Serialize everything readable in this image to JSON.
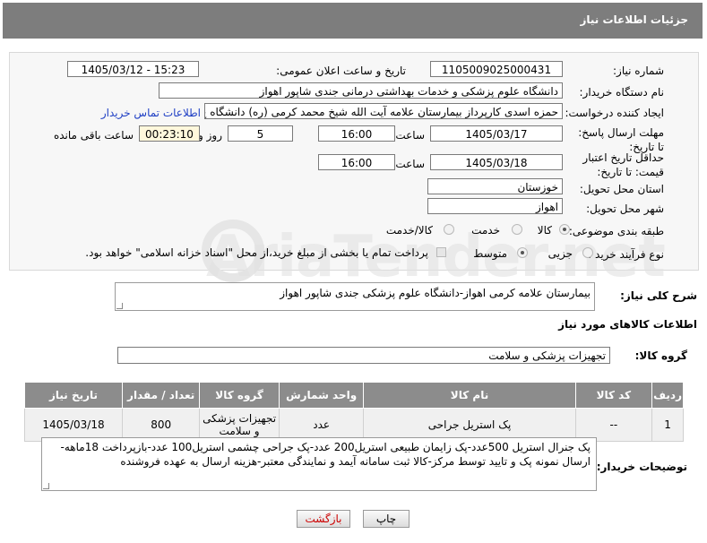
{
  "header": {
    "title": "جزئیات اطلاعات نیاز"
  },
  "form": {
    "need_number_label": "شماره نیاز:",
    "need_number": "1105009025000431",
    "announce_label": "تاریخ و ساعت اعلان عمومی:",
    "announce_value": "1405/03/12 - 15:23",
    "buyer_org_label": "نام دستگاه خریدار:",
    "buyer_org": "دانشگاه علوم پزشکی و خدمات بهداشتی درمانی جندی شاپور اهواز",
    "requester_label": "ایجاد کننده درخواست:",
    "requester": "حمزه اسدی کارپرداز بیمارستان علامه آیت الله شیخ محمد کرمی (ره) دانشگاه ع",
    "contact_link": "اطلاعات تماس خریدار",
    "deadline_label": "مهلت ارسال پاسخ: تا تاریخ:",
    "deadline_date": "1405/03/17",
    "time_label": "ساعت",
    "deadline_time": "16:00",
    "days_value": "5",
    "days_label": "روز و",
    "remaining_value": "00:23:10",
    "remaining_label": "ساعت باقی مانده",
    "validity_label": "حداقل تاریخ اعتبار قیمت: تا تاریخ:",
    "validity_date": "1405/03/18",
    "validity_time_label": "ساعت",
    "validity_time": "16:00",
    "province_label": "استان محل تحویل:",
    "province": "خوزستان",
    "city_label": "شهر محل تحویل:",
    "city": "اهواز",
    "category_label": "طبقه بندی موضوعی:",
    "category_options": [
      "کالا",
      "خدمت",
      "کالا/خدمت"
    ],
    "process_label": "نوع فرآیند خرید :",
    "process_options": [
      "جزیی",
      "متوسط"
    ],
    "payment_note": "پرداخت تمام یا بخشی از مبلغ خرید،از محل \"اسناد خزانه اسلامی\" خواهد بود."
  },
  "summary": {
    "label": "شرح کلی نیاز:",
    "value": "بیمارستان علامه کرمی اهواز-دانشگاه علوم پزشکی جندی شاپور اهواز"
  },
  "goods_info_title": "اطلاعات کالاهای مورد نیاز",
  "goods_group": {
    "label": "گروه کالا:",
    "value": "تجهیزات پزشکی و سلامت"
  },
  "table": {
    "headers": [
      "ردیف",
      "کد کالا",
      "نام کالا",
      "واحد شمارش",
      "گروه کالا",
      "تعداد / مقدار",
      "تاریخ نیاز"
    ],
    "rows": [
      [
        "1",
        "--",
        "پک استریل جراحی",
        "عدد",
        "تجهیزات پزشکی و سلامت",
        "800",
        "1405/03/18"
      ]
    ]
  },
  "buyer_notes": {
    "label": "توضیحات خریدار:",
    "value": "پک جنرال استریل 500عدد-پک زایمان طبیعی استریل200 عدد-پک  جراحی چشمی  استریل100 عدد-بازپرداخت 18ماهه-ارسال نمونه پک و تایید توسط مرکز-کالا ثبت سامانه آیمد و نمایندگی معتبر-هزینه ارسال به عهده فروشنده"
  },
  "buttons": {
    "print": "چاپ",
    "back": "بازگشت"
  },
  "watermark": "AriaTender.net",
  "colors": {
    "header_bg": "#7d7d7d",
    "link": "#1f3fc4",
    "back_text": "#cc0000",
    "yellow_box": "#fff8dc"
  }
}
